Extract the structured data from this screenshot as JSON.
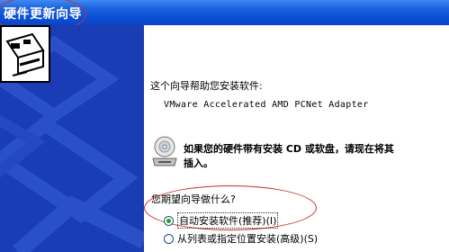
{
  "window": {
    "title": "硬件更新向导"
  },
  "intro": "这个向导帮助您安装软件:",
  "device_name": "VMware Accelerated AMD PCNet Adapter",
  "insert_message": "如果您的硬件带有安装 CD 或软盘，请现在将其插入。",
  "question": "您期望向导做什么?",
  "options": [
    {
      "label": "自动安装软件(推荐)(I)",
      "selected": true
    },
    {
      "label": "从列表或指定位置安装(高级)(S)",
      "selected": false
    }
  ],
  "icons": {
    "wizard": "hardware-card-icon",
    "cd": "cd-drive-icon"
  },
  "colors": {
    "titlebar": "#0a4fd6",
    "leftpanel": "#1a3cb4",
    "annotation": "#c9302c",
    "radio_dot": "#21a121"
  }
}
